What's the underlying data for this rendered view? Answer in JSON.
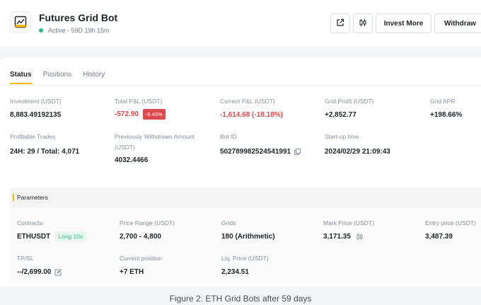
{
  "header": {
    "title": "Futures Grid Bot",
    "status": "Active - 59D 19h 15m",
    "buttons": {
      "invest_more": "Invest More",
      "withdraw": "Withdraw"
    },
    "icons": [
      "grid-bot-icon",
      "share-icon",
      "candlestick-icon"
    ],
    "status_color": "#2ebd85"
  },
  "tabs": [
    {
      "label": "Status",
      "active": true
    },
    {
      "label": "Positions",
      "active": false
    },
    {
      "label": "History",
      "active": false
    }
  ],
  "status": {
    "investment": {
      "label": "Investment (USDT)",
      "value": "8,883.49192135"
    },
    "total_pnl": {
      "label": "Total P&L (USDT)",
      "value": "-572.90",
      "badge": "-6.45%"
    },
    "current_pnl": {
      "label": "Current P&L (USDT)",
      "value": "-1,614.68 (-18.18%)"
    },
    "grid_profit": {
      "label": "Grid Profit (USDT)",
      "value": "+2,852.77"
    },
    "grid_apr": {
      "label": "Grid APR",
      "value": "+198.66%"
    },
    "profitable_trades": {
      "label": "Profitable Trades",
      "value": "24H: 29 / Total: 4,071"
    },
    "withdrawn": {
      "label_line1": "Previously Withdrawn Amount",
      "label_line2": "(USDT)",
      "value": "4032.4466"
    },
    "bot_id": {
      "label": "Bot ID",
      "value": "502789982524541991"
    },
    "startup_time": {
      "label": "Start-up time",
      "value": "2024/02/29 21:09:43"
    }
  },
  "parameters": {
    "title": "Parameters",
    "contracts": {
      "label": "Contracts",
      "value": "ETHUSDT",
      "badge": "Long 10x"
    },
    "price_range": {
      "label": "Price Range (USDT)",
      "value": "2,700 - 4,800"
    },
    "grids": {
      "label": "Grids",
      "value": "180 (Arithmetic)"
    },
    "mark_price": {
      "label": "Mark Price (USDT)",
      "value": "3,171.35"
    },
    "entry_price": {
      "label": "Entry price (USDT)",
      "value": "3,487.39"
    },
    "tp_sl": {
      "label": "TP/SL",
      "value": "--/2,699.00"
    },
    "current_position": {
      "label": "Current position",
      "value": "+7 ETH"
    },
    "liq_price": {
      "label": "Liq. Price (USDT)",
      "value": "2,234.51"
    }
  },
  "caption": "Figure 2. ETH Grid Bots after 59 days",
  "colors": {
    "accent": "#f0b90b",
    "negative": "#e0464b",
    "positive": "#2ebd85"
  }
}
